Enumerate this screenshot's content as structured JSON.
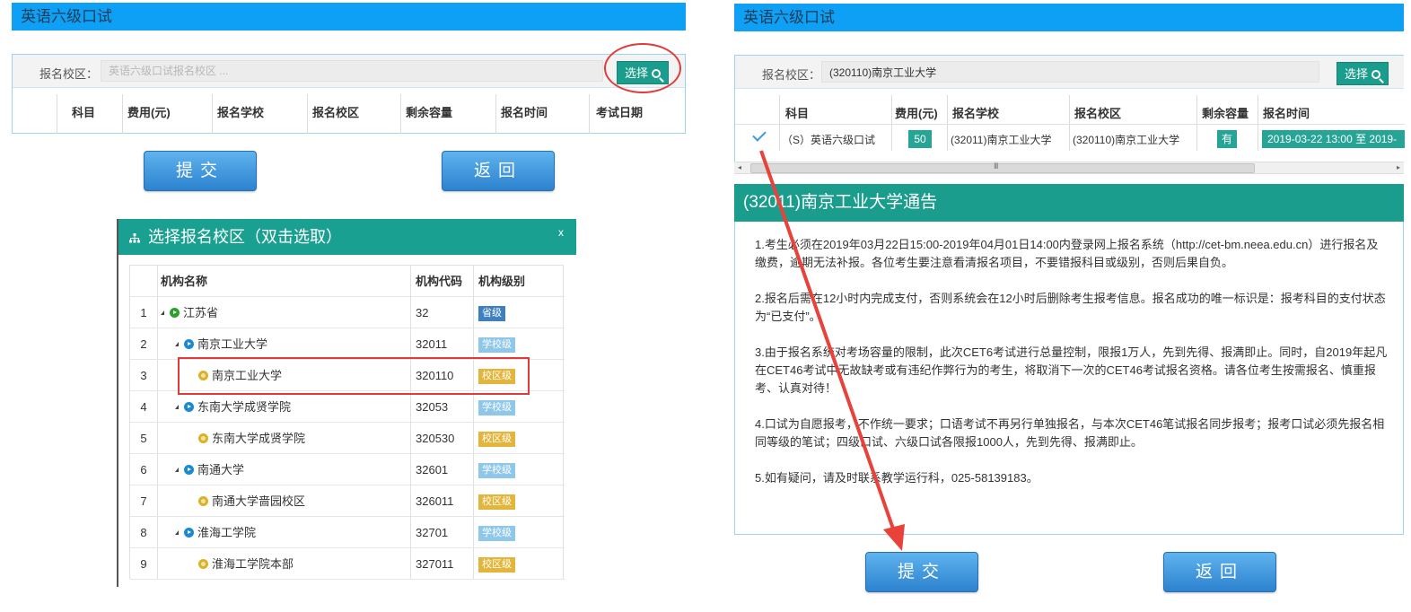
{
  "left": {
    "title": "英语六级口试",
    "search_label": "报名校区：",
    "search_placeholder": "英语六级口试报名校区 ...",
    "select_button": "选择",
    "columns": [
      "科目",
      "费用(元)",
      "报名学校",
      "报名校区",
      "剩余容量",
      "报名时间",
      "考试日期"
    ],
    "submit": "提交",
    "back": "返回"
  },
  "dialog": {
    "title": "选择报名校区（双击选取）",
    "close": "x",
    "columns": [
      "机构名称",
      "机构代码",
      "机构级别"
    ],
    "rows": [
      {
        "num": "1",
        "name": "江苏省",
        "code": "32",
        "level": "省级",
        "level_type": "prov",
        "depth": 0,
        "node": "green"
      },
      {
        "num": "2",
        "name": "南京工业大学",
        "code": "32011",
        "level": "学校级",
        "level_type": "school",
        "depth": 1,
        "node": "blue"
      },
      {
        "num": "3",
        "name": "南京工业大学",
        "code": "320110",
        "level": "校区级",
        "level_type": "campus",
        "depth": 2,
        "node": "yellow"
      },
      {
        "num": "4",
        "name": "东南大学成贤学院",
        "code": "32053",
        "level": "学校级",
        "level_type": "school",
        "depth": 1,
        "node": "blue"
      },
      {
        "num": "5",
        "name": "东南大学成贤学院",
        "code": "320530",
        "level": "校区级",
        "level_type": "campus",
        "depth": 2,
        "node": "yellow"
      },
      {
        "num": "6",
        "name": "南通大学",
        "code": "32601",
        "level": "学校级",
        "level_type": "school",
        "depth": 1,
        "node": "blue"
      },
      {
        "num": "7",
        "name": "南通大学啬园校区",
        "code": "326011",
        "level": "校区级",
        "level_type": "campus",
        "depth": 2,
        "node": "yellow"
      },
      {
        "num": "8",
        "name": "淮海工学院",
        "code": "32701",
        "level": "学校级",
        "level_type": "school",
        "depth": 1,
        "node": "blue"
      },
      {
        "num": "9",
        "name": "淮海工学院本部",
        "code": "327011",
        "level": "校区级",
        "level_type": "campus",
        "depth": 2,
        "node": "yellow"
      }
    ]
  },
  "right": {
    "title": "英语六级口试",
    "search_label": "报名校区：",
    "search_value": "(320110)南京工业大学",
    "select_button": "选择",
    "columns": [
      "科目",
      "费用(元)",
      "报名学校",
      "报名校区",
      "剩余容量",
      "报名时间"
    ],
    "row": {
      "subject": "（S）英语六级口试",
      "fee": "50",
      "school": "(32011)南京工业大学",
      "campus": "(320110)南京工业大学",
      "capacity": "有",
      "time": "2019-03-22 13:00 至 2019-"
    },
    "scroll_grip": "III",
    "notice_title": "(32011)南京工业大学通告",
    "notice": [
      "1.考生必须在2019年03月22日15:00-2019年04月01日14:00内登录网上报名系统（http://cet-bm.neea.edu.cn）进行报名及缴费，逾期无法补报。各位考生要注意看清报名项目，不要错报科目或级别，否则后果自负。",
      "2.报名后需在12小时内完成支付，否则系统会在12小时后删除考生报考信息。报名成功的唯一标识是：报考科目的支付状态为“已支付”。",
      "3.由于报名系统对考场容量的限制，此次CET6考试进行总量控制，限报1万人，先到先得、报满即止。同时，自2019年起凡在CET46考试中无故缺考或有违纪作弊行为的考生，将取消下一次的CET46考试报名资格。请各位考生按需报名、慎重报考、认真对待！",
      "4.口试为自愿报考，不作统一要求；口语考试不再另行单独报名，与本次CET46笔试报名同步报考；报考口试必须先报名相同等级的笔试；四级口试、六级口试各限报1000人，先到先得、报满即止。",
      "5.如有疑问，请及时联系教学运行科，025-58139183。"
    ],
    "submit": "提交",
    "back": "返回"
  }
}
